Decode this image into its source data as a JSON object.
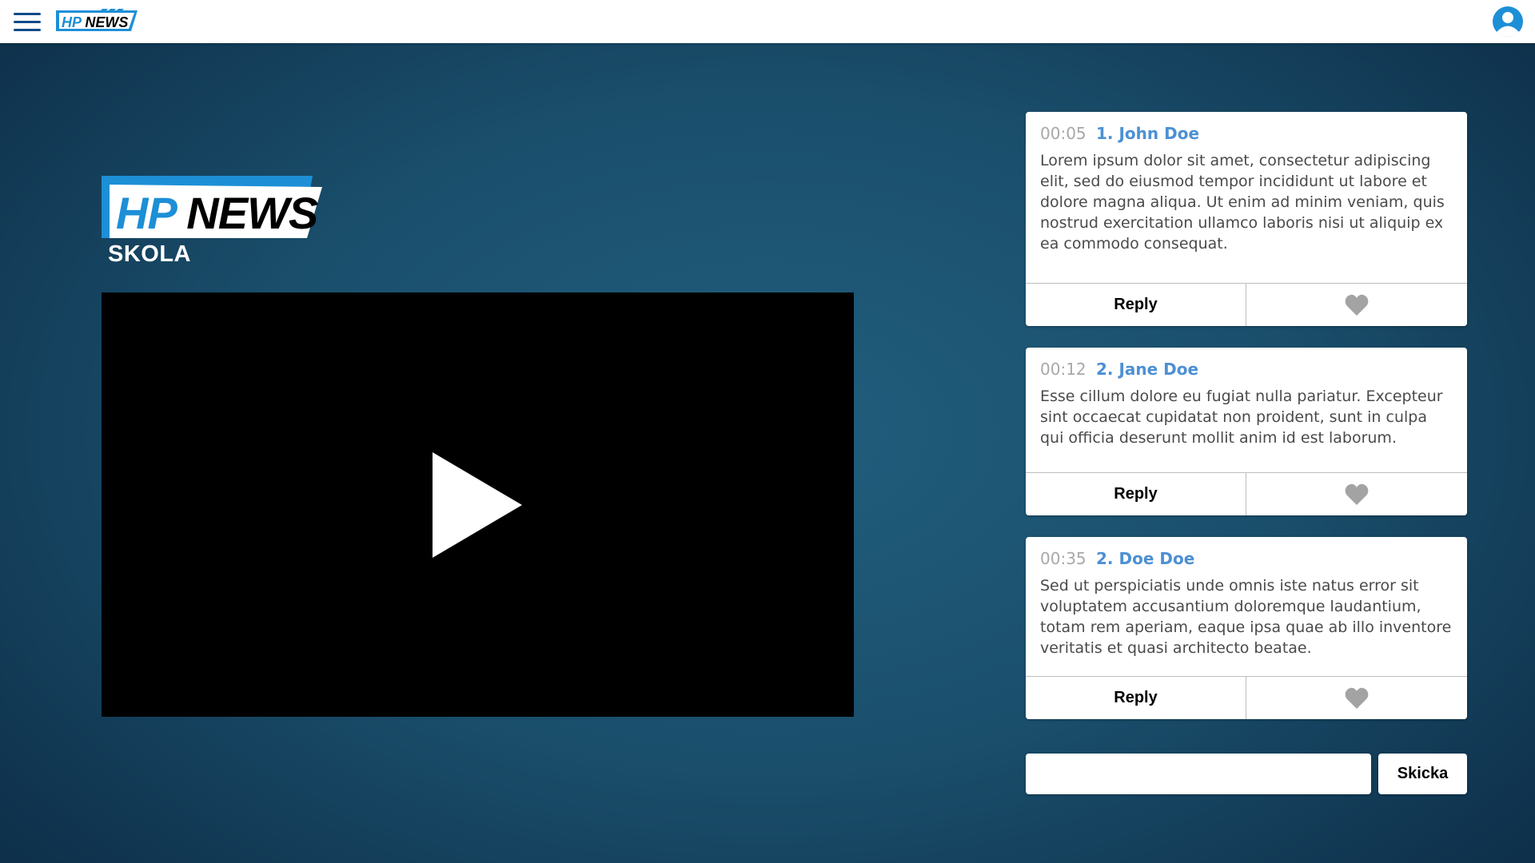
{
  "header": {
    "menu_icon": "hamburger-menu-icon",
    "logo_text": "HP NEWS",
    "profile_icon": "user-avatar-icon"
  },
  "show": {
    "logo_text": "HP NEWS",
    "subtitle": "SKOLA"
  },
  "video": {
    "play_icon": "play-icon"
  },
  "colors": {
    "brand_blue": "#1d8fd6",
    "menu_blue": "#0f4a8a",
    "author_blue": "#4d90d3",
    "timestamp_gray": "#a8a8a8",
    "heart_gray": "#a3a3a3"
  },
  "comments": [
    {
      "time": "00:05",
      "author": "1. John Doe",
      "text": "Lorem ipsum dolor sit amet, consectetur adipiscing elit, sed do eiusmod tempor incididunt ut labore et dolore magna aliqua. Ut enim ad minim veniam, quis nostrud exercitation ullamco laboris nisi ut aliquip ex ea commodo consequat.",
      "reply_label": "Reply",
      "like_icon": "heart-icon"
    },
    {
      "time": "00:12",
      "author": "2. Jane Doe",
      "text": "Esse cillum dolore eu fugiat nulla pariatur. Excepteur sint occaecat cupidatat non proident, sunt in culpa qui officia deserunt mollit anim id est laborum.",
      "reply_label": "Reply",
      "like_icon": "heart-icon"
    },
    {
      "time": "00:35",
      "author": "2. Doe Doe",
      "text": "Sed ut perspiciatis unde omnis iste natus error sit voluptatem accusantium doloremque laudantium, totam rem aperiam, eaque ipsa quae ab illo inventore veritatis et quasi architecto beatae.",
      "reply_label": "Reply",
      "like_icon": "heart-icon"
    }
  ],
  "composer": {
    "input_value": "",
    "send_label": "Skicka"
  }
}
